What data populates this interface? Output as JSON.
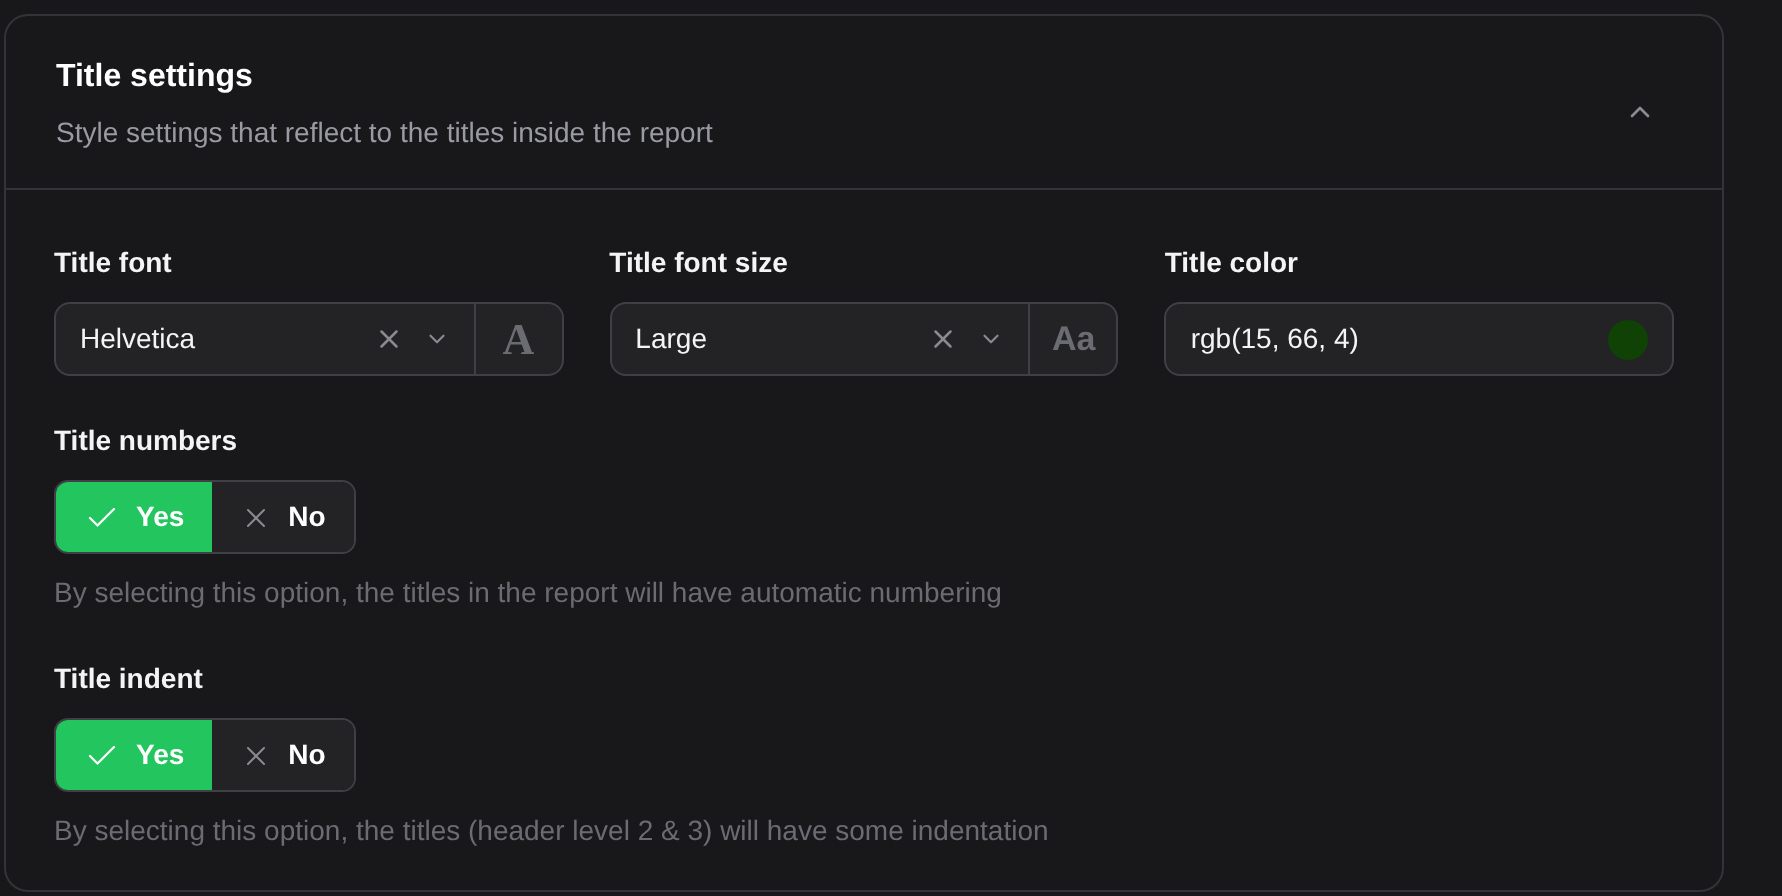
{
  "panel": {
    "title": "Title settings",
    "subtitle": "Style settings that reflect to the titles inside the report",
    "expanded": true
  },
  "selects": [
    {
      "kind": "select",
      "label": "Title font",
      "value": "Helvetica",
      "icon_text": "A",
      "serif": true
    },
    {
      "kind": "select",
      "label": "Title font size",
      "value": "Large",
      "icon_text": "Aa",
      "serif": false
    },
    {
      "kind": "color",
      "label": "Title color",
      "value": "rgb(15, 66, 4)",
      "color": "#0f4204"
    }
  ],
  "toggles": [
    {
      "label": "Title numbers",
      "options": [
        {
          "label": "Yes",
          "kind": "check",
          "selected": true
        },
        {
          "label": "No",
          "kind": "cross",
          "selected": false
        }
      ],
      "help": "By selecting this option, the titles in the report will have automatic numbering"
    },
    {
      "label": "Title indent",
      "options": [
        {
          "label": "Yes",
          "kind": "check",
          "selected": true
        },
        {
          "label": "No",
          "kind": "cross",
          "selected": false
        }
      ],
      "help": "By selecting this option, the titles (header level 2 & 3) will have some indentation"
    }
  ]
}
